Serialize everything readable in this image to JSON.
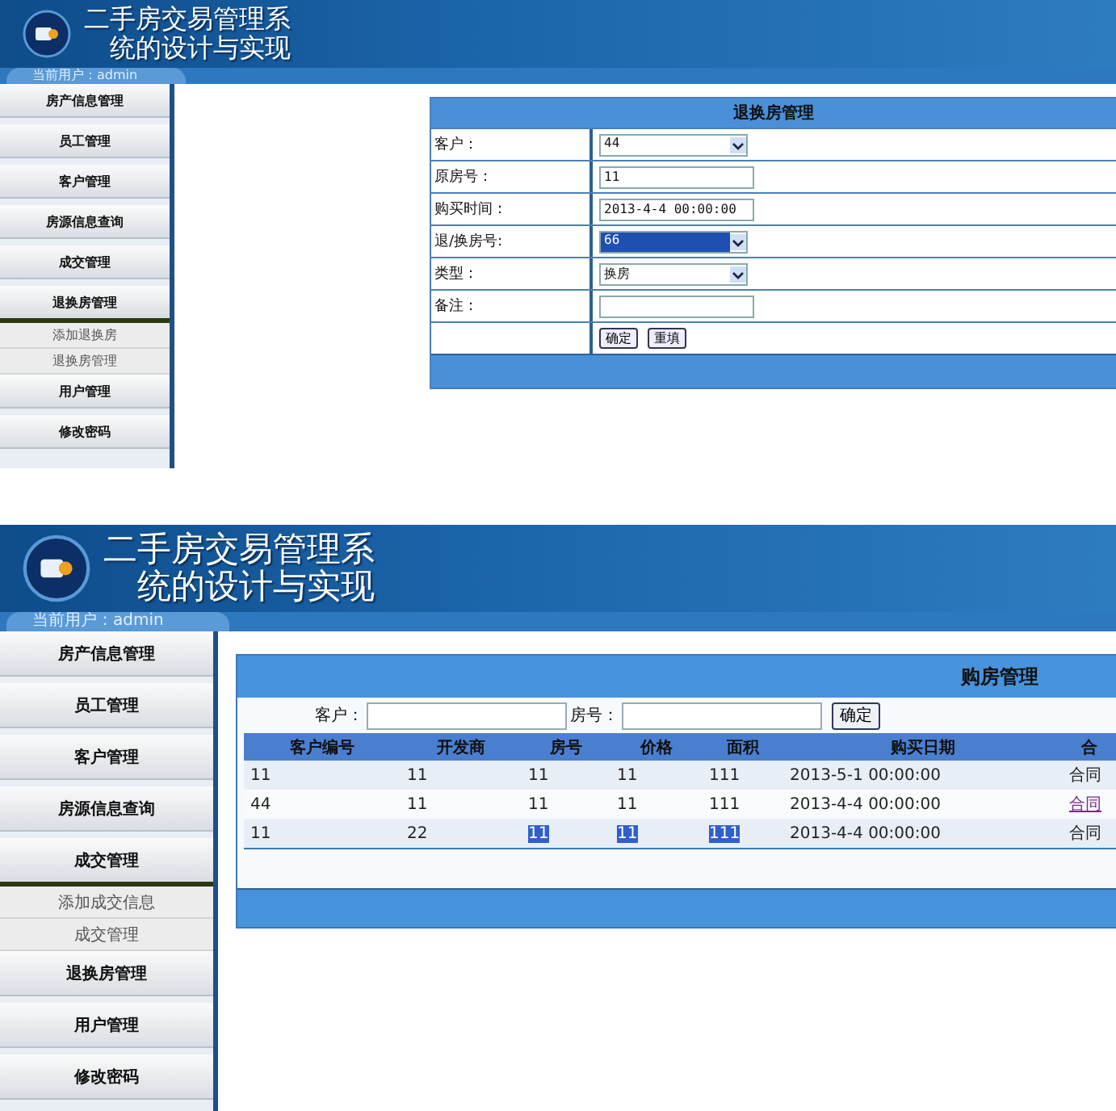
{
  "screens": [
    {
      "header": {
        "title_line_1": "二手房交易管理系",
        "title_line_2": "统的设计与实现"
      },
      "user_bar": "当前用户：admin",
      "sidebar": {
        "items": [
          {
            "label": "房产信息管理",
            "expanded": false
          },
          {
            "label": "员工管理",
            "expanded": false
          },
          {
            "label": "客户管理",
            "expanded": false
          },
          {
            "label": "房源信息查询",
            "expanded": false
          },
          {
            "label": "成交管理",
            "expanded": false
          },
          {
            "label": "退换房管理",
            "expanded": true,
            "children": [
              {
                "label": "添加退换房"
              },
              {
                "label": "退换房管理"
              }
            ]
          },
          {
            "label": "用户管理",
            "expanded": false
          },
          {
            "label": "修改密码",
            "expanded": false
          }
        ]
      },
      "panel": {
        "kind": "form",
        "title": "退换房管理",
        "fields": [
          {
            "label": "客户：",
            "kind": "select",
            "value": "44",
            "focused": false
          },
          {
            "label": "原房号：",
            "kind": "input",
            "value": "11"
          },
          {
            "label": "购买时间：",
            "kind": "input",
            "value": "2013-4-4 00:00:00"
          },
          {
            "label": "退/换房号:",
            "kind": "select",
            "value": "66",
            "focused": true
          },
          {
            "label": "类型：",
            "kind": "select",
            "value": "换房",
            "focused": false
          },
          {
            "label": "备注：",
            "kind": "input"
          }
        ],
        "buttons": [
          "确定",
          "重填"
        ]
      }
    },
    {
      "header": {
        "title_line_1": "二手房交易管理系",
        "title_line_2": "统的设计与实现"
      },
      "user_bar": "当前用户：admin",
      "sidebar": {
        "items": [
          {
            "label": "房产信息管理",
            "expanded": false
          },
          {
            "label": "员工管理",
            "expanded": false
          },
          {
            "label": "客户管理",
            "expanded": false
          },
          {
            "label": "房源信息查询",
            "expanded": false
          },
          {
            "label": "成交管理",
            "expanded": true,
            "children": [
              {
                "label": "添加成交信息"
              },
              {
                "label": "成交管理"
              }
            ]
          },
          {
            "label": "退换房管理",
            "expanded": false
          },
          {
            "label": "用户管理",
            "expanded": false
          },
          {
            "label": "修改密码",
            "expanded": false
          }
        ]
      },
      "panel": {
        "kind": "table",
        "title": "购房管理",
        "search": [
          {
            "label": "客户："
          },
          {
            "label": "房号："
          }
        ],
        "search_button": "确定",
        "columns": [
          "客户编号",
          "开发商",
          "房号",
          "价格",
          "面积",
          "购买日期",
          "合"
        ],
        "rows": [
          {
            "cells": [
              {
                "text": "11",
                "highlighted": false
              },
              {
                "text": "11",
                "highlighted": false
              },
              {
                "text": "11",
                "highlighted": false
              },
              {
                "text": "11",
                "highlighted": false
              },
              {
                "text": "111",
                "highlighted": false
              },
              {
                "text": "2013-5-1 00:00:00",
                "highlighted": false
              }
            ],
            "contract": {
              "text": "合同",
              "link": false
            }
          },
          {
            "cells": [
              {
                "text": "44",
                "highlighted": false
              },
              {
                "text": "11",
                "highlighted": false
              },
              {
                "text": "11",
                "highlighted": false
              },
              {
                "text": "11",
                "highlighted": false
              },
              {
                "text": "111",
                "highlighted": false
              },
              {
                "text": "2013-4-4 00:00:00",
                "highlighted": false
              }
            ],
            "contract": {
              "text": "合同",
              "link": true
            }
          },
          {
            "cells": [
              {
                "text": "11",
                "highlighted": false
              },
              {
                "text": "22",
                "highlighted": false
              },
              {
                "text": "11",
                "highlighted": true
              },
              {
                "text": "11",
                "highlighted": true
              },
              {
                "text": "111",
                "highlighted": true
              },
              {
                "text": "2013-4-4 00:00:00",
                "highlighted": false
              }
            ],
            "contract": {
              "text": "合同",
              "link": false
            }
          }
        ]
      }
    }
  ]
}
